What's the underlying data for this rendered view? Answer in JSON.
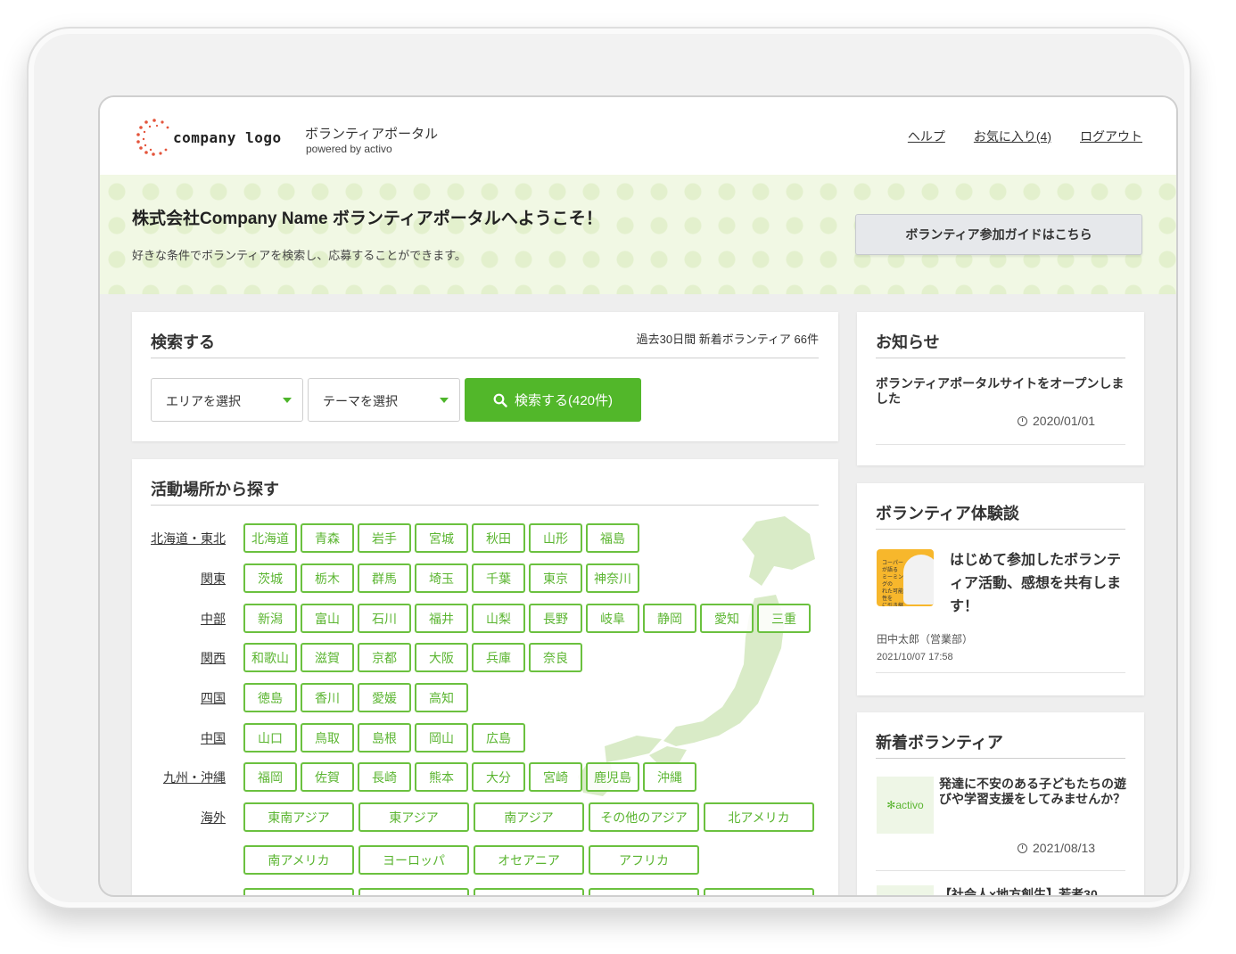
{
  "header": {
    "logo_text": "company logo",
    "portal_title": "ボランティアポータル",
    "portal_sub": "powered by activo",
    "nav": [
      "ヘルプ",
      "お気に入り(4)",
      "ログアウト"
    ]
  },
  "hero": {
    "title": "株式会社Company Name ボランティアポータルへようこそ！",
    "description": "好きな条件でボランティアを検索し、応募することができます。",
    "guide_button": "ボランティア参加ガイドはこちら"
  },
  "search": {
    "title": "検索する",
    "new_count": "過去30日間 新着ボランティア 66件",
    "area_select": "エリアを選択",
    "theme_select": "テーマを選択",
    "button": "検索する(420件)"
  },
  "areas": {
    "title": "活動場所から探す",
    "regions": [
      {
        "label": "北海道・東北",
        "prefs": [
          "北海道",
          "青森",
          "岩手",
          "宮城",
          "秋田",
          "山形",
          "福島"
        ]
      },
      {
        "label": "関東",
        "prefs": [
          "茨城",
          "栃木",
          "群馬",
          "埼玉",
          "千葉",
          "東京",
          "神奈川"
        ]
      },
      {
        "label": "中部",
        "prefs": [
          "新潟",
          "富山",
          "石川",
          "福井",
          "山梨",
          "長野",
          "岐阜",
          "静岡",
          "愛知",
          "三重"
        ]
      },
      {
        "label": "関西",
        "prefs": [
          "和歌山",
          "滋賀",
          "京都",
          "大阪",
          "兵庫",
          "奈良"
        ]
      },
      {
        "label": "四国",
        "prefs": [
          "徳島",
          "香川",
          "愛媛",
          "高知"
        ]
      },
      {
        "label": "中国",
        "prefs": [
          "山口",
          "鳥取",
          "島根",
          "岡山",
          "広島"
        ]
      },
      {
        "label": "九州・沖縄",
        "prefs": [
          "福岡",
          "佐賀",
          "長崎",
          "熊本",
          "大分",
          "宮崎",
          "鹿児島",
          "沖縄"
        ]
      },
      {
        "label": "海外",
        "prefs": [
          "東南アジア",
          "東アジア",
          "南アジア",
          "その他のアジア",
          "北アメリカ",
          "南アメリカ",
          "ヨーロッパ",
          "オセアニア",
          "アフリカ"
        ]
      }
    ]
  },
  "news": {
    "title": "お知らせ",
    "item_text": "ボランティアポータルサイトをオープンしました",
    "item_date": "2020/01/01"
  },
  "story": {
    "title": "ボランティア体験談",
    "thumb_text": "コーパーが語る\nミーミングの\nれた可能性を\nに引き継ぐ",
    "text": "はじめて参加したボランティア活動、感想を共有します！",
    "author": "田中太郎（営業部）",
    "time": "2021/10/07 17:58"
  },
  "new_volunteer": {
    "title": "新着ボランティア",
    "thumb_text": "✻activo",
    "item_text": "発達に不安のある子どもたちの遊びや学習支援をしてみませんか？",
    "item_date": "2021/08/13",
    "next_text": "【社会人×地方創生】若者30"
  },
  "colors": {
    "accent": "#52b72a",
    "hero_bg": "#f1f8e4"
  }
}
